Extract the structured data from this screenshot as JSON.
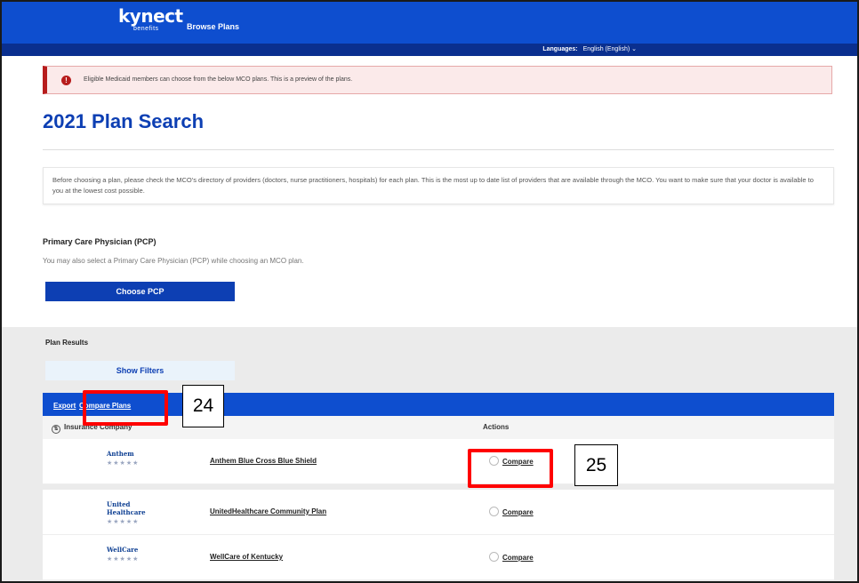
{
  "header": {
    "logo": "kynect",
    "logo_sub": "benefits",
    "nav_browse": "Browse Plans",
    "language_label": "Languages:",
    "language_value": "English (English)"
  },
  "alert": {
    "text": "Eligible Medicaid members can choose from the below MCO plans. This is a preview of the plans."
  },
  "page": {
    "title": "2021 Plan Search",
    "info": "Before choosing a plan, please check the MCO's directory of providers (doctors, nurse practitioners, hospitals) for each plan. This is the most up to date list of providers that are available through the MCO. You want to make sure that your doctor is available to you at the lowest cost possible."
  },
  "pcp": {
    "title": "Primary Care Physician (PCP)",
    "description": "You may also select a Primary Care Physician (PCP) while choosing an MCO plan.",
    "button_label": "Choose PCP"
  },
  "results": {
    "title": "Plan Results",
    "filters_label": "Show Filters",
    "tabs": {
      "export": "Export",
      "compare": "Compare Plans"
    },
    "columns": {
      "insurance_company": "Insurance Company",
      "actions": "Actions"
    },
    "rows": [
      {
        "logo_text": "Anthem",
        "plan": "Anthem Blue Cross Blue Shield",
        "action": "Compare"
      },
      {
        "logo_text": "United Healthcare",
        "plan": "UnitedHealthcare Community Plan",
        "action": "Compare"
      },
      {
        "logo_text": "WellCare",
        "plan": "WellCare of Kentucky",
        "action": "Compare"
      }
    ]
  },
  "callouts": {
    "c24": "24",
    "c25": "25"
  },
  "colors": {
    "brand_blue": "#0e4ecf",
    "title_blue": "#0d3fb3",
    "callout_red": "#ff0000"
  },
  "icons": {
    "alert": "alert-circle-icon",
    "sort": "sort-icon",
    "dropdown": "chevron-down-icon"
  }
}
